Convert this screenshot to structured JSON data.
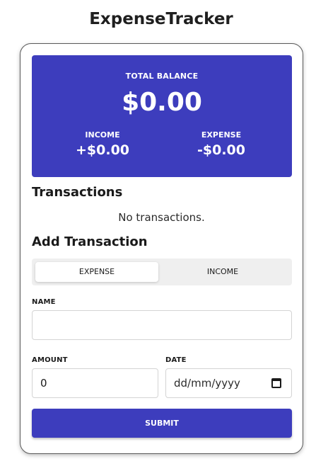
{
  "app": {
    "title": "ExpenseTracker"
  },
  "balance": {
    "total_label": "TOTAL BALANCE",
    "total_value": "$0.00",
    "income_label": "INCOME",
    "income_value": "+$0.00",
    "expense_label": "EXPENSE",
    "expense_value": "-$0.00"
  },
  "transactions": {
    "title": "Transactions",
    "empty_text": "No transactions."
  },
  "add": {
    "title": "Add Transaction",
    "toggle": {
      "expense": "EXPENSE",
      "income": "INCOME",
      "selected": "EXPENSE"
    },
    "name_label": "NAME",
    "name_value": "",
    "amount_label": "AMOUNT",
    "amount_value": "0",
    "date_label": "DATE",
    "date_placeholder": "dd/mm/yyyy",
    "submit_label": "SUBMIT"
  },
  "colors": {
    "accent": "#3d3dbd",
    "card_border": "#5a5a5a",
    "toggle_bg": "#efefef"
  },
  "icons": {
    "date_picker": "calendar-icon"
  }
}
